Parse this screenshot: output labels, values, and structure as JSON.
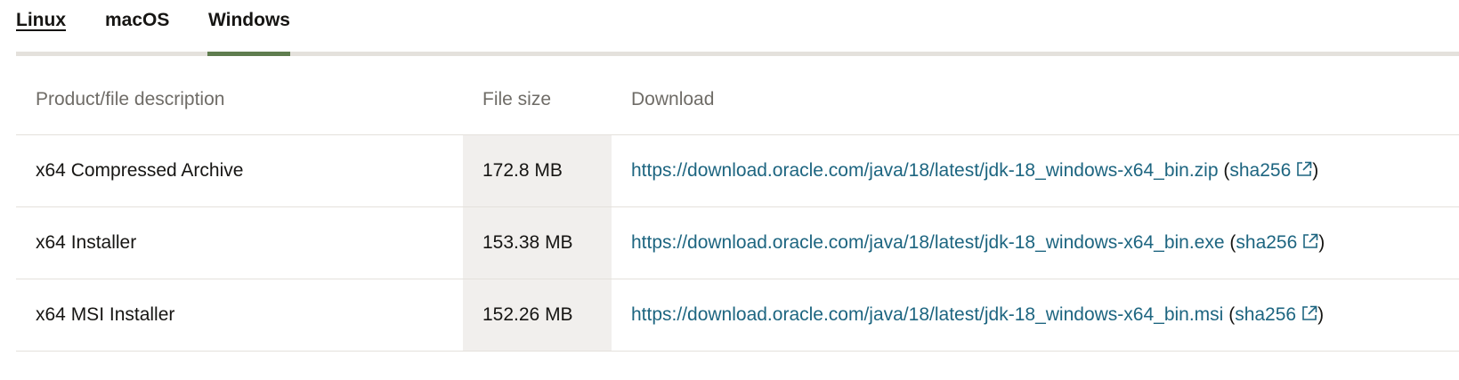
{
  "tabs": {
    "items": [
      {
        "label": "Linux"
      },
      {
        "label": "macOS"
      },
      {
        "label": "Windows"
      }
    ],
    "selected": "Windows"
  },
  "table": {
    "headers": {
      "description": "Product/file description",
      "size": "File size",
      "download": "Download"
    },
    "rows": [
      {
        "description": "x64 Compressed Archive",
        "size": "172.8 MB",
        "url": "https://download.oracle.com/java/18/latest/jdk-18_windows-x64_bin.zip",
        "checksum_label": "sha256"
      },
      {
        "description": "x64 Installer",
        "size": "153.38 MB",
        "url": "https://download.oracle.com/java/18/latest/jdk-18_windows-x64_bin.exe",
        "checksum_label": "sha256"
      },
      {
        "description": "x64 MSI Installer",
        "size": "152.26 MB",
        "url": "https://download.oracle.com/java/18/latest/jdk-18_windows-x64_bin.msi",
        "checksum_label": "sha256"
      }
    ],
    "open_paren": "(",
    "close_paren": ")"
  },
  "icons": {
    "external_link": "external-link-icon"
  },
  "colors": {
    "tab_indicator": "#5f7d4f",
    "link": "#1d6580",
    "size_column_bg": "#f1efed",
    "header_text": "#6f6c67",
    "divider": "#e4e1dc"
  }
}
